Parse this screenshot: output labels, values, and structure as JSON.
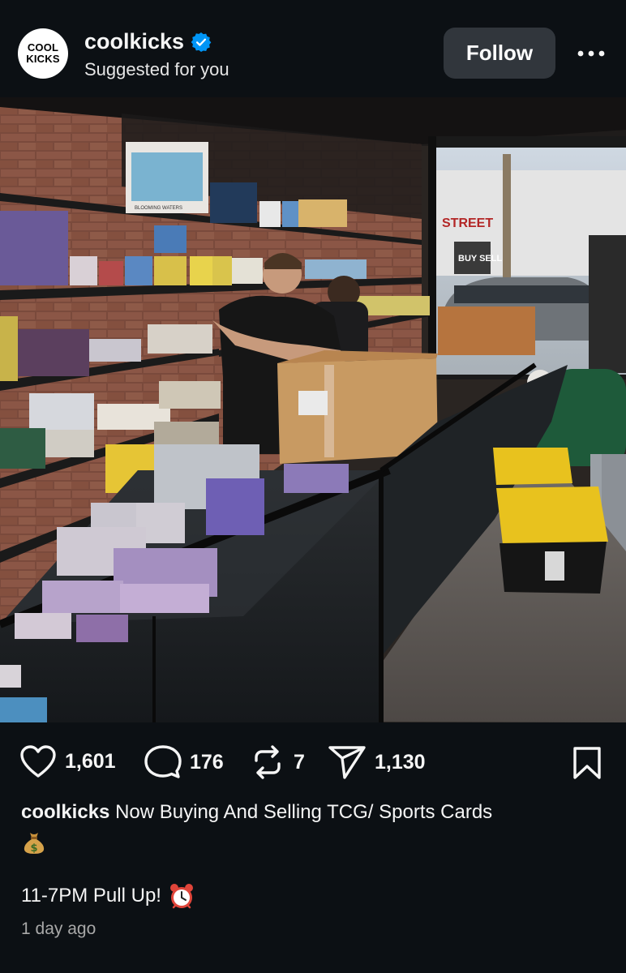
{
  "header": {
    "avatar_line1": "COOL",
    "avatar_line2": "KICKS",
    "username": "coolkicks",
    "subtitle": "Suggested for you",
    "follow_label": "Follow",
    "more_icon": "more-horizontal-icon"
  },
  "photo": {
    "description_icon": "store-photo",
    "storefront_text": "STREET",
    "storefront_sign": "BUY SELL",
    "box_label": "BLOOMING WATERS"
  },
  "actions": {
    "likes": "1,601",
    "comments": "176",
    "reposts": "7",
    "shares": "1,130"
  },
  "caption": {
    "user": "coolkicks",
    "text": " Now Buying And Selling TCG/  Sports Cards",
    "line2": "11-7PM Pull Up!",
    "timestamp": "1 day ago"
  },
  "colors": {
    "background": "#0c1014",
    "follow_bg": "#31363c",
    "verified": "#0095f6",
    "muted": "#a8a8a8"
  }
}
